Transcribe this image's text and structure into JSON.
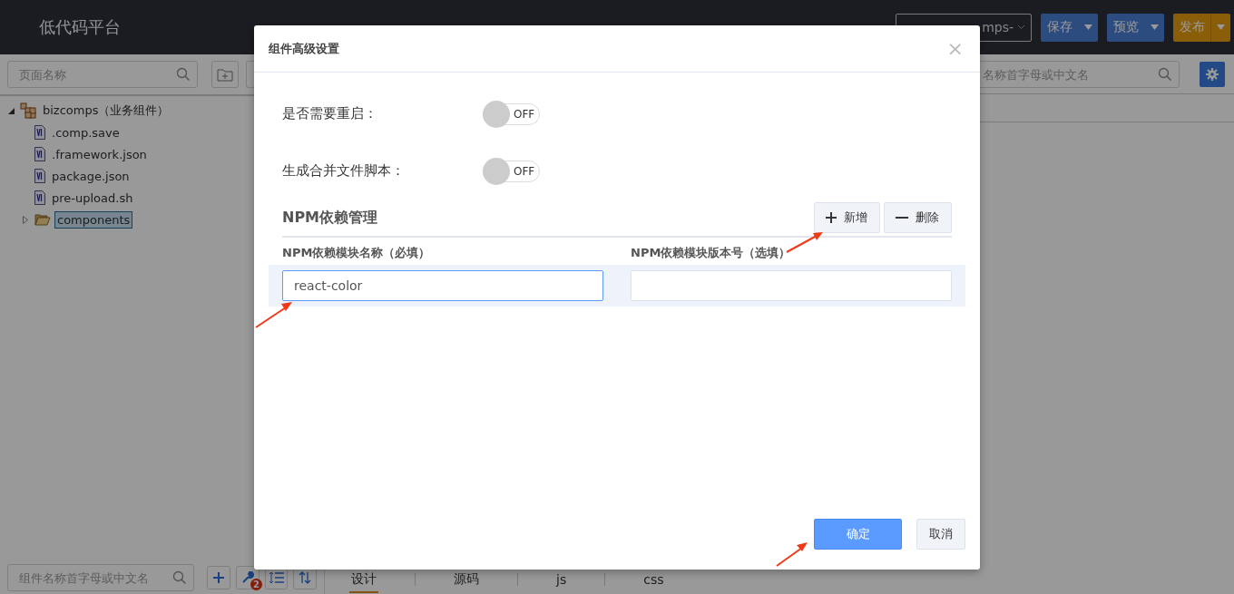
{
  "app": {
    "title": "低代码平台"
  },
  "project_select": {
    "value": "mps-"
  },
  "actions": [
    {
      "label": "保存",
      "kind": "primary"
    },
    {
      "label": "预览",
      "kind": "primary"
    },
    {
      "label": "发布",
      "kind": "warning"
    }
  ],
  "left_panel": {
    "search": {
      "placeholder": "页面名称"
    },
    "tree": [
      {
        "label": "bizcomps（业务组件）",
        "kind": "project",
        "expanded": true,
        "selected": false,
        "children": [
          {
            "label": ".comp.save",
            "kind": "file",
            "selected": false
          },
          {
            "label": ".framework.json",
            "kind": "file",
            "selected": false
          },
          {
            "label": "package.json",
            "kind": "file",
            "selected": false
          },
          {
            "label": "pre-upload.sh",
            "kind": "file",
            "selected": false
          },
          {
            "label": "components",
            "kind": "folder",
            "expanded": false,
            "selected": true
          }
        ]
      }
    ],
    "bottom_search": {
      "placeholder": "组件名称首字母或中文名"
    },
    "badge": "2"
  },
  "editor_tabs": [
    {
      "label": "设计",
      "selected": true
    },
    {
      "label": "源码",
      "selected": false
    },
    {
      "label": "js",
      "selected": false
    },
    {
      "label": "css",
      "selected": false
    }
  ],
  "right_panel": {
    "search": {
      "placeholder": "名称首字母或中文名"
    }
  },
  "dialog": {
    "title": "组件高级设置",
    "close": "×",
    "switches": [
      {
        "label": "是否需要重启：",
        "on": false,
        "text": "OFF"
      },
      {
        "label": "生成合并文件脚本：",
        "on": false,
        "text": "OFF"
      }
    ],
    "section_title": "NPM依赖管理",
    "section_buttons": [
      {
        "label": "新增",
        "kind": "add"
      },
      {
        "label": "删除",
        "kind": "remove"
      }
    ],
    "columns": [
      "NPM依赖模块名称（必填）",
      "NPM依赖模块版本号（选填）"
    ],
    "rows": [
      {
        "name": "react-color",
        "version": "",
        "selected": true
      }
    ],
    "buttons": [
      {
        "label": "确定",
        "kind": "primary"
      },
      {
        "label": "取消",
        "kind": "default"
      }
    ]
  }
}
